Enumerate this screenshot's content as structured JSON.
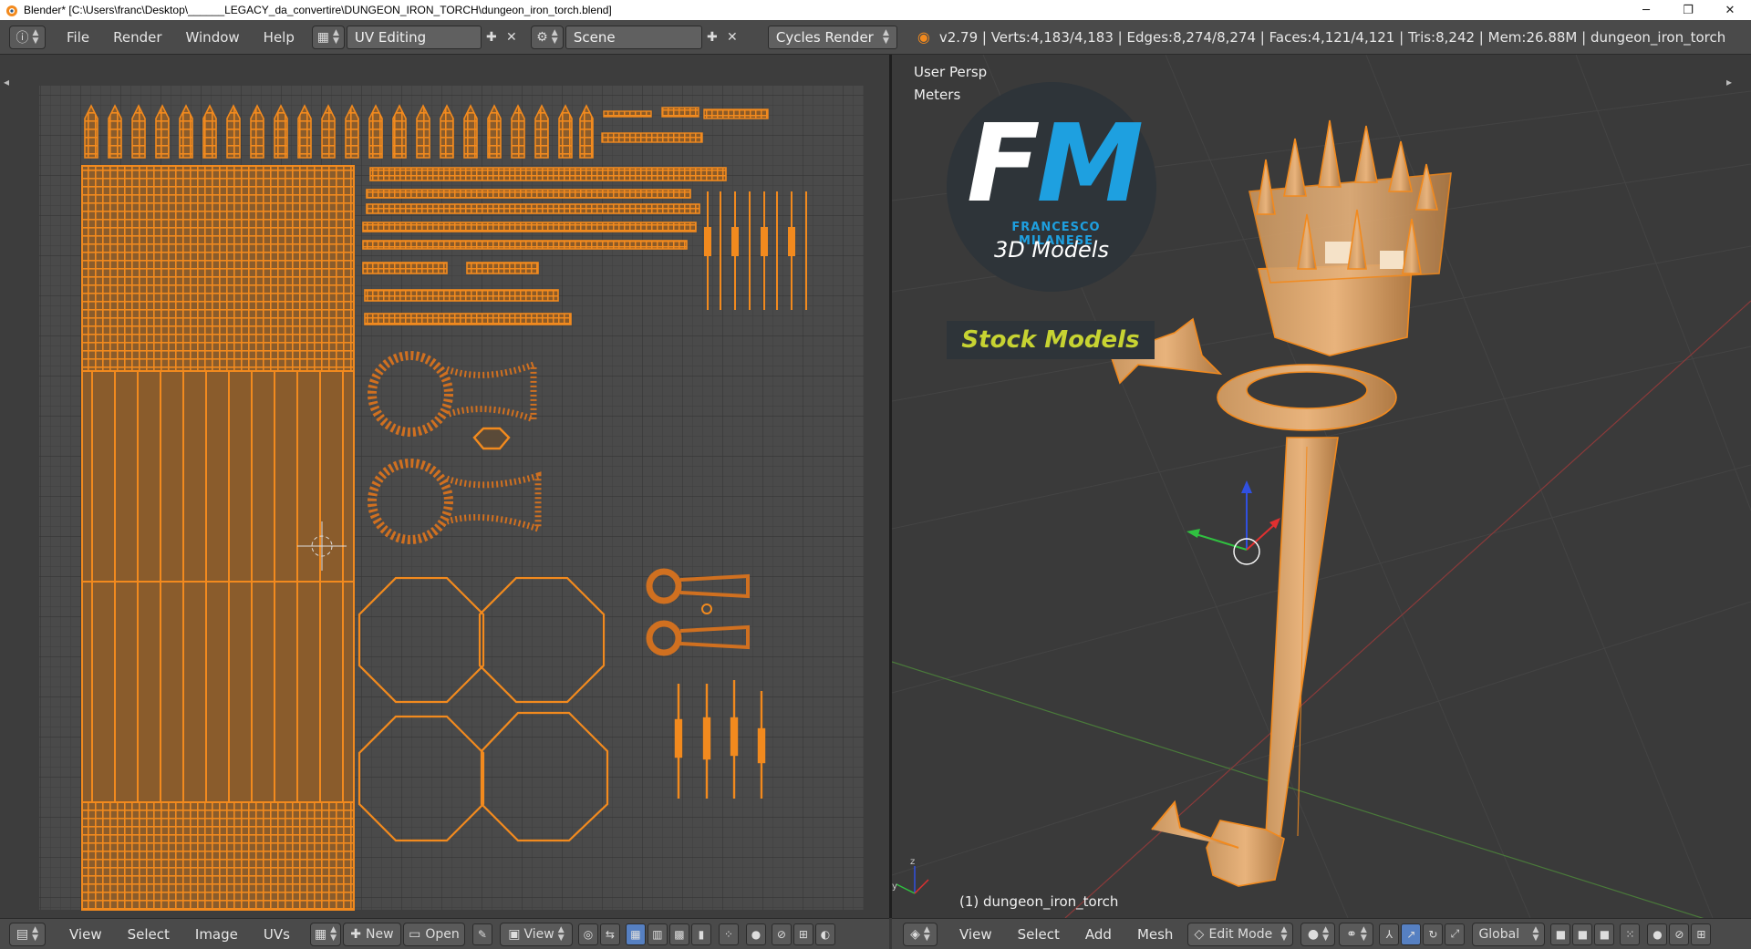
{
  "window": {
    "title": "Blender* [C:\\Users\\franc\\Desktop\\______LEGACY_da_convertire\\DUNGEON_IRON_TORCH\\dungeon_iron_torch.blend]",
    "controls": [
      "─",
      "❐",
      "✕"
    ]
  },
  "topbar": {
    "menus": [
      "File",
      "Render",
      "Window",
      "Help"
    ],
    "screen_layout": "UV Editing",
    "scene": "Scene",
    "render_engine": "Cycles Render",
    "stats": "v2.79 | Verts:4,183/4,183 | Edges:8,274/8,274 | Faces:4,121/4,121 | Tris:8,242 | Mem:26.88M | dungeon_iron_torch"
  },
  "uv_bottombar": {
    "menus": [
      "View",
      "Select",
      "Image",
      "UVs"
    ],
    "new_label": "New",
    "open_label": "Open",
    "view_label": "View"
  },
  "viewport": {
    "persp_label": "User Persp",
    "units_label": "Meters",
    "object_label": "(1) dungeon_iron_torch",
    "logo": {
      "name": "FRANCESCO MILANESE",
      "sub": "3D Models",
      "stock": "Stock Models"
    }
  },
  "vp_bottombar": {
    "menus": [
      "View",
      "Select",
      "Add",
      "Mesh"
    ],
    "mode": "Edit Mode",
    "orientation": "Global"
  },
  "colors": {
    "uv_orange": "#f28a1e",
    "mesh_orange": "#e38b2c",
    "grid_bg": "#4a4a4a",
    "logo_blue": "#1ea0e0",
    "logo_yellow": "#c7d332",
    "active_blue": "#5680c2"
  }
}
